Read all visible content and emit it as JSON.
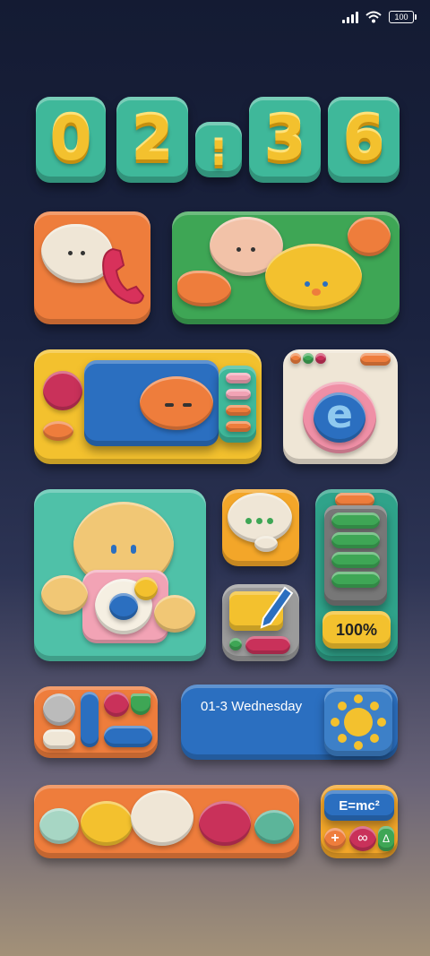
{
  "status_bar": {
    "signal_icon": "signal-bars-icon",
    "wifi_icon": "wifi-icon",
    "battery_level": "100"
  },
  "clock": {
    "hour_tens": "0",
    "hour_ones": "2",
    "separator": ":",
    "minute_tens": "3",
    "minute_ones": "6"
  },
  "widgets": {
    "date_text": "01-3 Wednesday",
    "battery_percent": "100%",
    "formula": "E=mc²",
    "plus_symbol": "+",
    "infinity_symbol": "∞",
    "delta_symbol": "Δ",
    "browser_letter": "e"
  },
  "colors": {
    "teal": "#3fb89a",
    "yellow": "#f3c12e",
    "orange": "#ee7d3c",
    "green": "#3ea655",
    "blue": "#2b6fc0",
    "cream": "#efe6d6"
  }
}
